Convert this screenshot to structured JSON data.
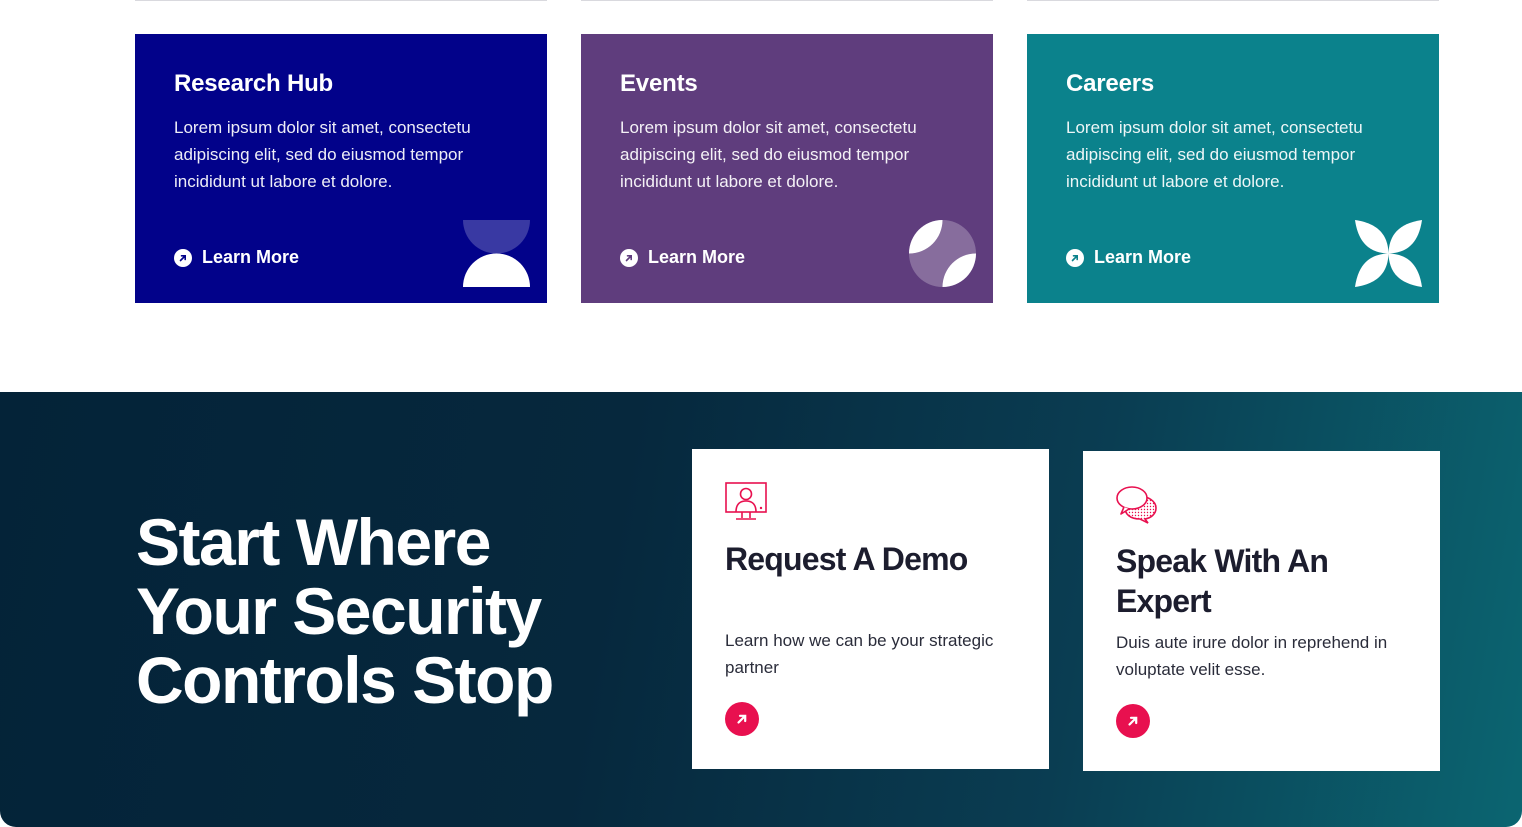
{
  "colors": {
    "research_hub": "#02028a",
    "events": "#5f3d7d",
    "careers": "#0b828c",
    "accent": "#e8104f",
    "cta_dark": "#042338"
  },
  "feature_cards": [
    {
      "title": "Research Hub",
      "text": "Lorem ipsum dolor sit amet, consectetu adipiscing elit, sed do eiusmod tempor incididunt ut labore et dolore.",
      "link_label": "Learn More",
      "icon": "hourglass-shape-icon"
    },
    {
      "title": "Events",
      "text": "Lorem ipsum dolor sit amet, consectetu adipiscing elit, sed do eiusmod tempor incididunt ut labore et dolore.",
      "link_label": "Learn More",
      "icon": "sparkle-shape-icon"
    },
    {
      "title": "Careers",
      "text": "Lorem ipsum dolor sit amet, consectetu adipiscing elit, sed do eiusmod tempor incididunt ut labore et dolore.",
      "link_label": "Learn More",
      "icon": "petal-x-shape-icon"
    }
  ],
  "cta": {
    "headline": "Start Where Your Security Controls Stop",
    "cards": [
      {
        "title": "Request A Demo",
        "text": "Learn how we can be your strategic partner",
        "icon": "monitor-user-icon"
      },
      {
        "title": "Speak With An Expert",
        "text": "Duis aute irure dolor in reprehend in voluptate velit esse.",
        "icon": "chat-bubbles-icon"
      }
    ]
  }
}
